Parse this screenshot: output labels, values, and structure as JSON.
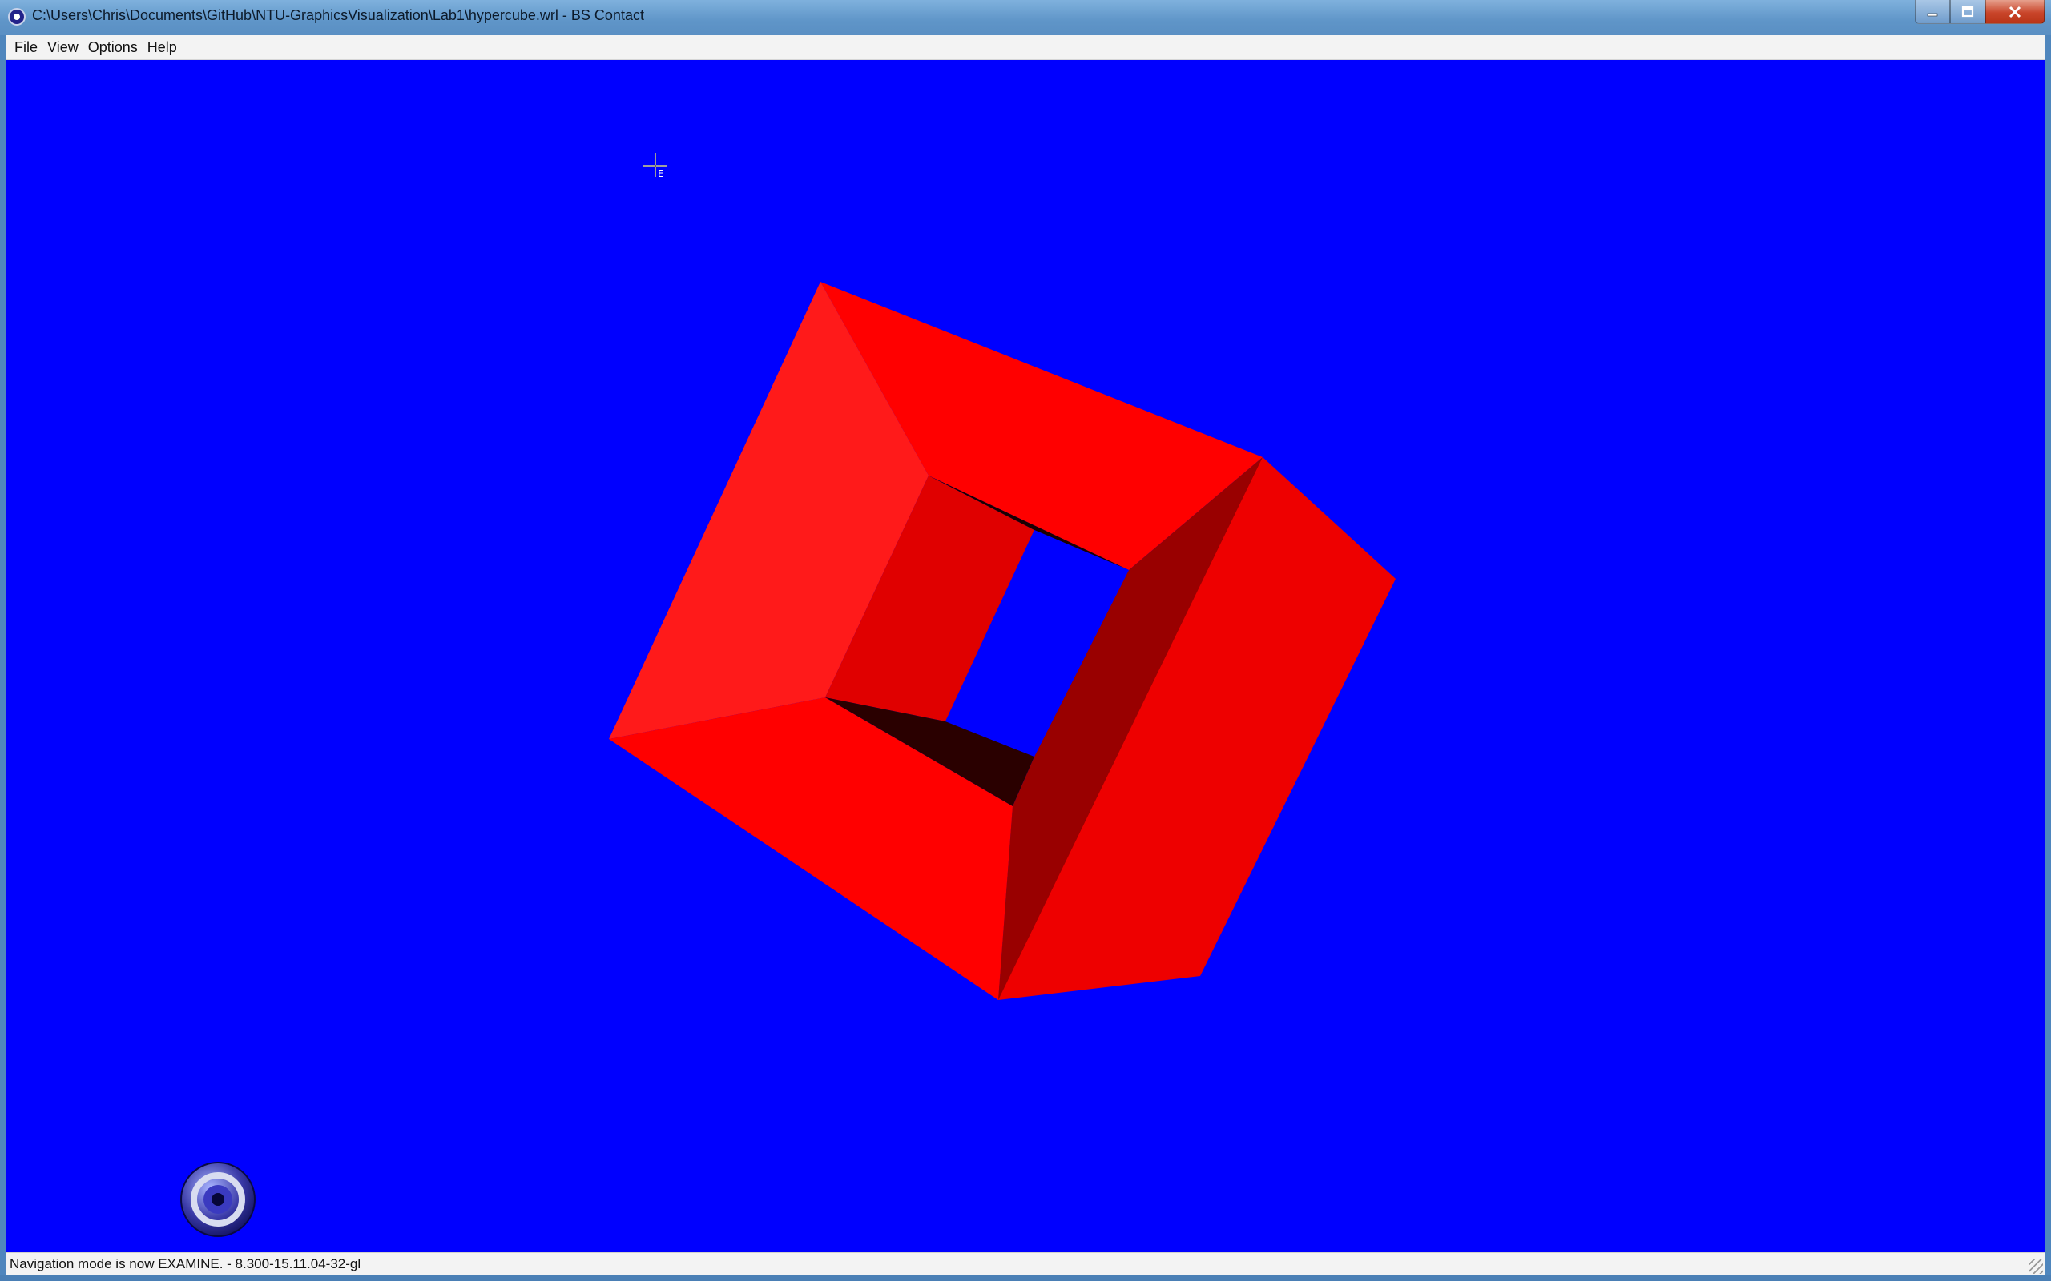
{
  "window": {
    "title": "C:\\Users\\Chris\\Documents\\GitHub\\NTU-GraphicsVisualization\\Lab1\\hypercube.wrl - BS Contact",
    "controls": {
      "minimize_icon": "minimize-icon",
      "maximize_icon": "maximize-icon",
      "close_icon": "close-icon"
    }
  },
  "menu": {
    "items": [
      {
        "label": "File"
      },
      {
        "label": "View"
      },
      {
        "label": "Options"
      },
      {
        "label": "Help"
      }
    ]
  },
  "viewport": {
    "background_color": "#0000ff",
    "object_color": "#ff0000",
    "object_description_icon": "hollow-cube-3d",
    "cursor_icon": "crosshair-examine-cursor",
    "cursor_glyph": "E",
    "navigation_widget_icon": "navigation-widget-icon"
  },
  "status": {
    "text": "Navigation mode is now EXAMINE.  -  8.300-15.11.04-32-gl"
  }
}
